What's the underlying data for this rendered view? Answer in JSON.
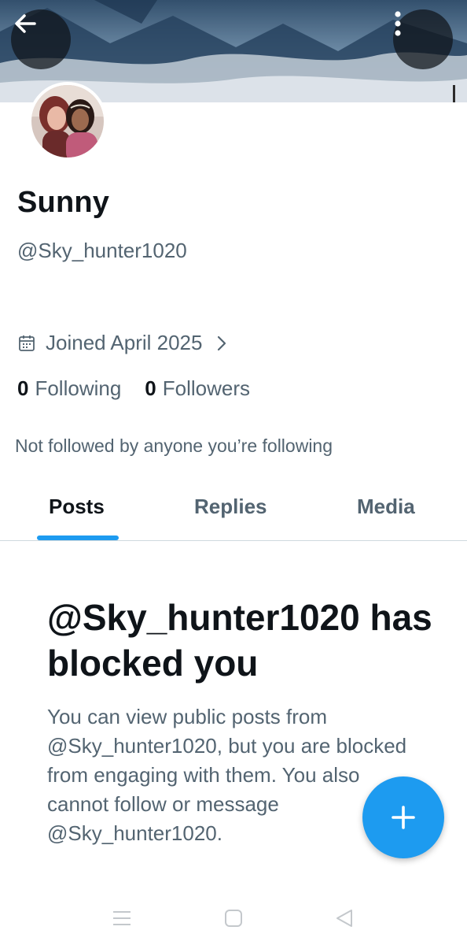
{
  "header": {
    "back_icon": "arrow-left-icon",
    "more_icon": "more-vertical-icon"
  },
  "profile": {
    "display_name": "Sunny",
    "handle": "@Sky_hunter1020",
    "joined": "Joined April 2025",
    "calendar_icon": "calendar-icon",
    "stats": {
      "following_count": "0",
      "following_label": "Following",
      "followers_count": "0",
      "followers_label": "Followers"
    },
    "not_followed_text": "Not followed by anyone you’re following"
  },
  "tabs": [
    {
      "label": "Posts",
      "active": true
    },
    {
      "label": "Replies",
      "active": false
    },
    {
      "label": "Media",
      "active": false
    }
  ],
  "blocked": {
    "title": "@Sky_hunter1020 has blocked you",
    "body": "You can view public posts from @Sky_hunter1020, but you are blocked from engaging with them. You also cannot follow or message @Sky_hunter1020."
  },
  "fab": {
    "icon": "plus-icon"
  },
  "system_nav": [
    "menu-icon",
    "home-square-icon",
    "back-triangle-icon"
  ],
  "colors": {
    "accent": "#1d9bf0",
    "text_primary": "#0f1419",
    "text_secondary": "#536471",
    "divider": "#cfd9de"
  }
}
